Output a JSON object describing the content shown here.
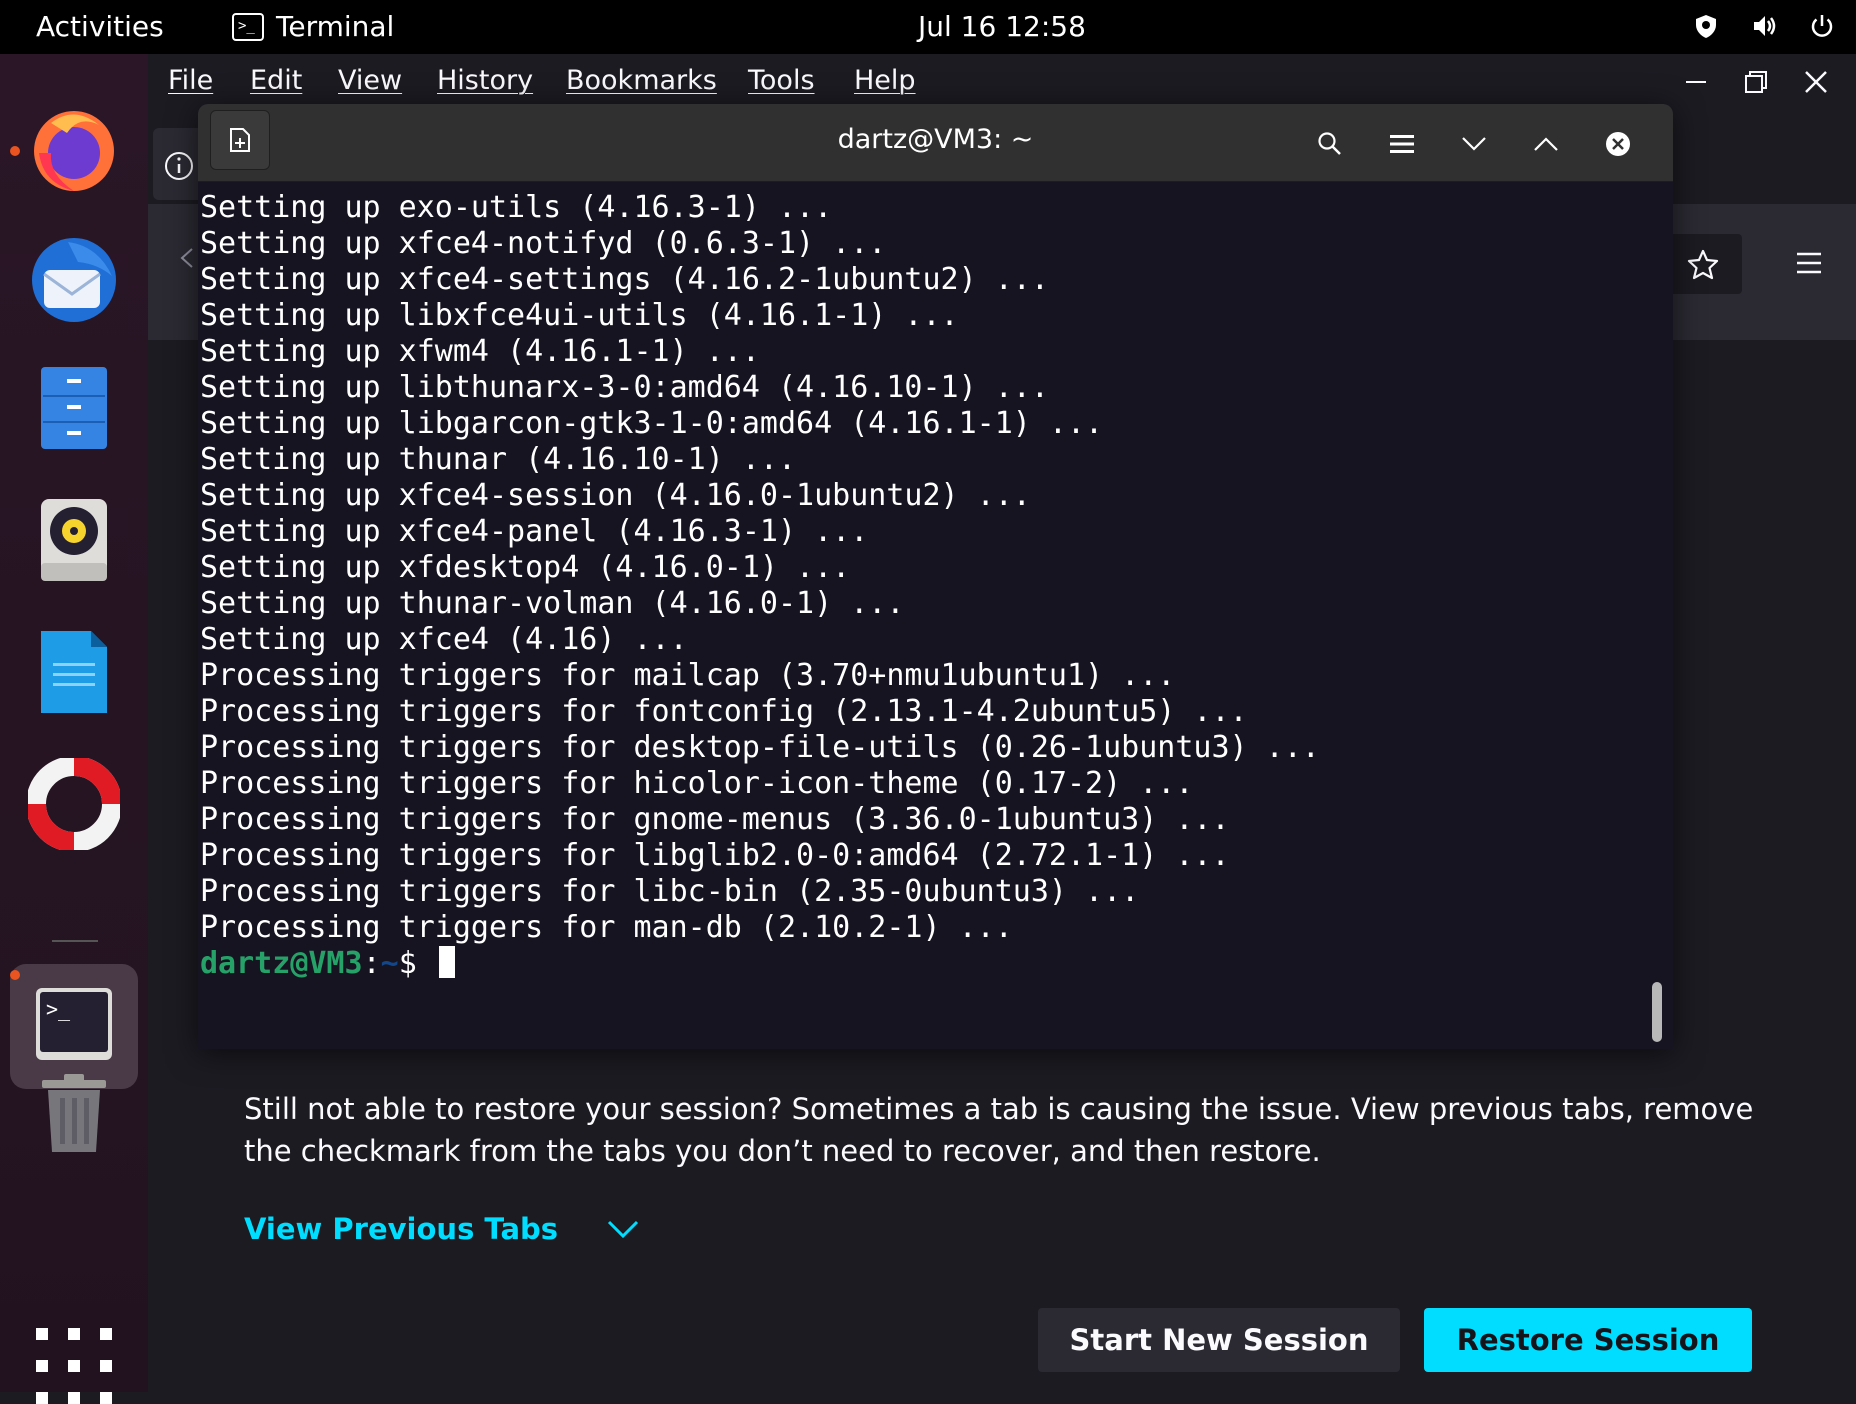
{
  "topbar": {
    "activities": "Activities",
    "app_name": "Terminal",
    "clock": "Jul 16  12:58"
  },
  "firefox": {
    "menu": [
      "File",
      "Edit",
      "View",
      "History",
      "Bookmarks",
      "Tools",
      "Help"
    ],
    "paragraph": "Still not able to restore your session? Sometimes a tab is causing the issue. View previous tabs, remove the checkmark from the tabs you don’t need to recover, and then restore.",
    "view_previous_tabs": "View Previous Tabs",
    "start_new_session": "Start New Session",
    "restore_session": "Restore Session"
  },
  "terminal": {
    "title": "dartz@VM3: ~",
    "lines": [
      "Setting up exo-utils (4.16.3-1) ...",
      "Setting up xfce4-notifyd (0.6.3-1) ...",
      "Setting up xfce4-settings (4.16.2-1ubuntu2) ...",
      "Setting up libxfce4ui-utils (4.16.1-1) ...",
      "Setting up xfwm4 (4.16.1-1) ...",
      "Setting up libthunarx-3-0:amd64 (4.16.10-1) ...",
      "Setting up libgarcon-gtk3-1-0:amd64 (4.16.1-1) ...",
      "Setting up thunar (4.16.10-1) ...",
      "Setting up xfce4-session (4.16.0-1ubuntu2) ...",
      "Setting up xfce4-panel (4.16.3-1) ...",
      "Setting up xfdesktop4 (4.16.0-1) ...",
      "Setting up thunar-volman (4.16.0-1) ...",
      "Setting up xfce4 (4.16) ...",
      "Processing triggers for mailcap (3.70+nmu1ubuntu1) ...",
      "Processing triggers for fontconfig (2.13.1-4.2ubuntu5) ...",
      "Processing triggers for desktop-file-utils (0.26-1ubuntu3) ...",
      "Processing triggers for hicolor-icon-theme (0.17-2) ...",
      "Processing triggers for gnome-menus (3.36.0-1ubuntu3) ...",
      "Processing triggers for libglib2.0-0:amd64 (2.72.1-1) ...",
      "Processing triggers for libc-bin (2.35-0ubuntu3) ...",
      "Processing triggers for man-db (2.10.2-1) ..."
    ],
    "prompt_user": "dartz@VM3",
    "prompt_sep": ":",
    "prompt_path": "~",
    "prompt_symbol": "$ "
  },
  "dock": {
    "icons": [
      "firefox-icon",
      "thunderbird-icon",
      "files-icon",
      "rhythmbox-icon",
      "writer-icon",
      "help-icon",
      "terminal-icon",
      "trash-icon",
      "app-grid-icon"
    ]
  },
  "colors": {
    "accent_cyan": "#00ddff",
    "ubuntu_orange": "#e95420",
    "prompt_green": "#26a269"
  }
}
